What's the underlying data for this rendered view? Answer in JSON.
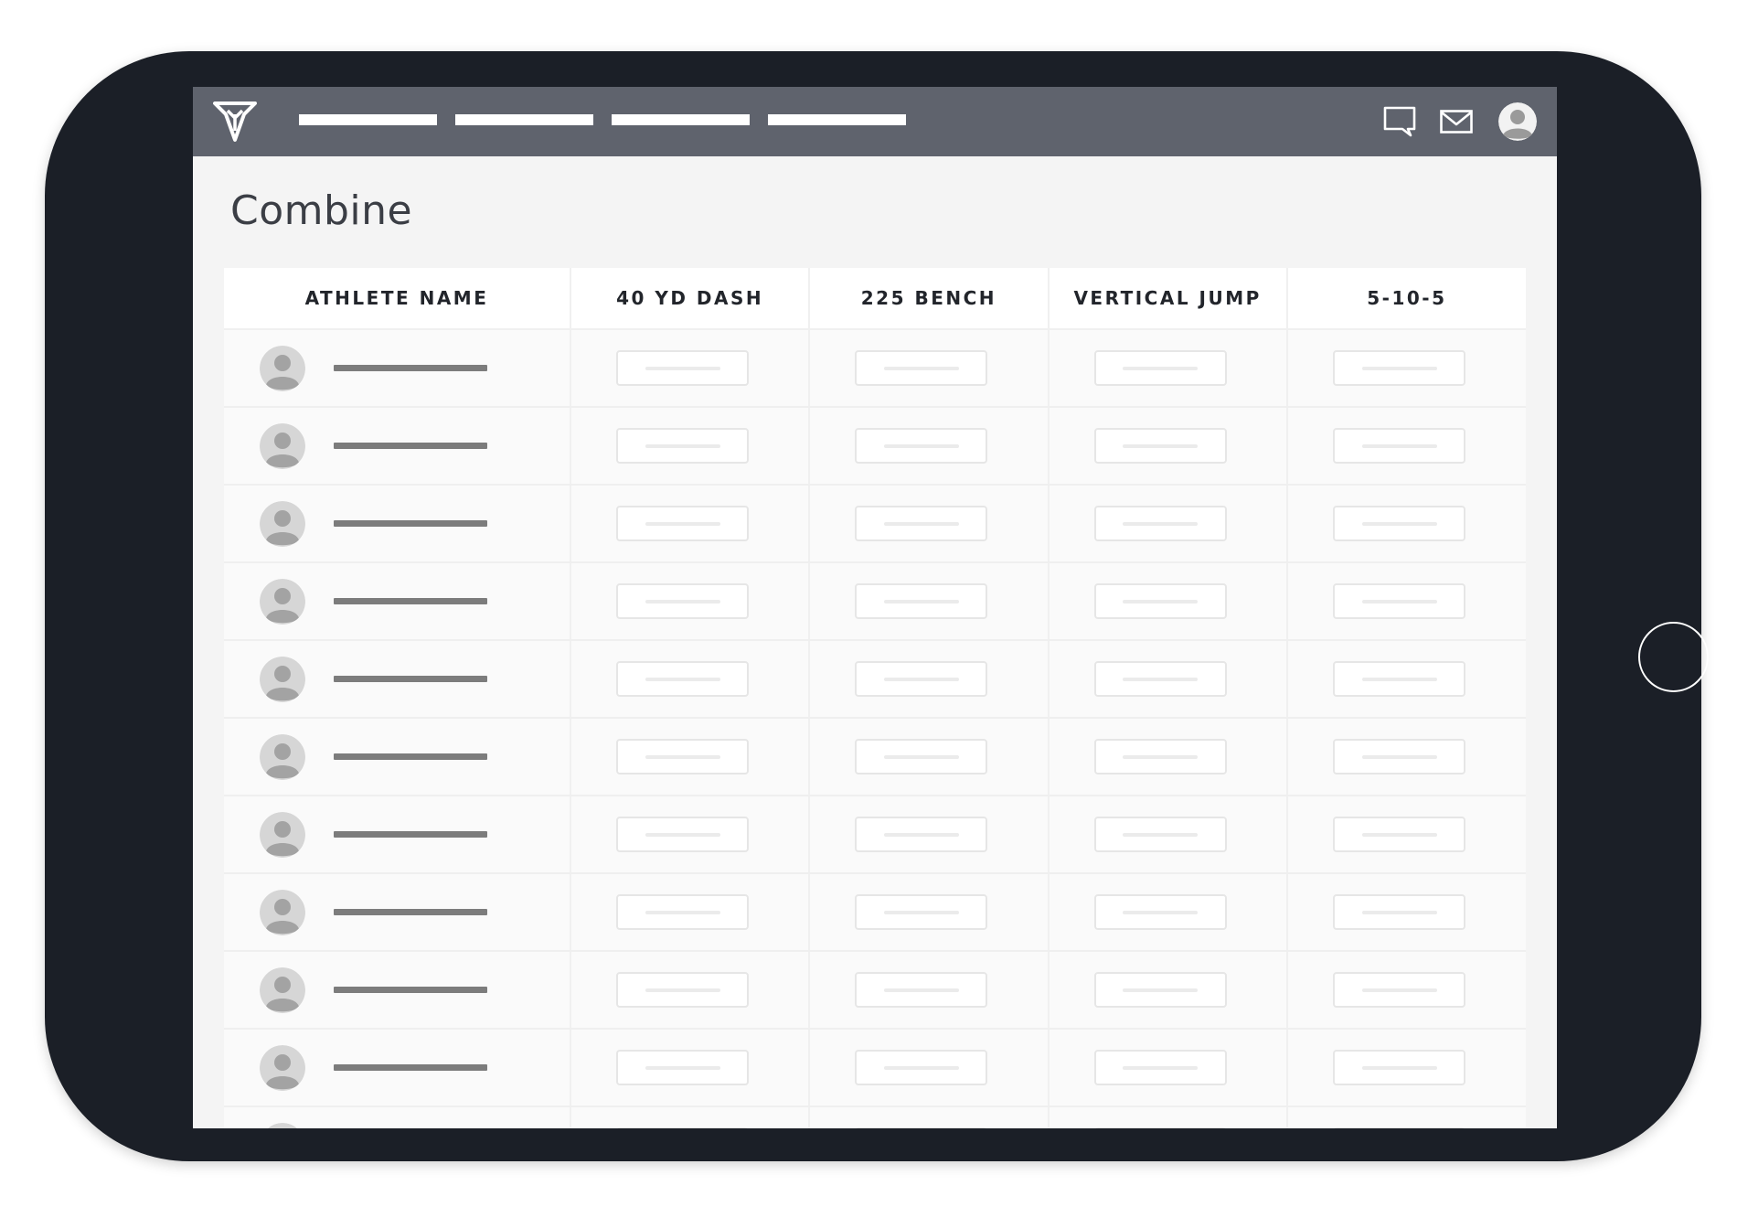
{
  "page": {
    "title": "Combine"
  },
  "navbar": {
    "logo_icon": "arrowhead-logo-icon",
    "links": [
      "",
      "",
      "",
      ""
    ],
    "right_icons": [
      "chat-icon",
      "mail-icon",
      "user-avatar-icon"
    ]
  },
  "table": {
    "columns": [
      "ATHLETE NAME",
      "40 YD DASH",
      "225 BENCH",
      "VERTICAL JUMP",
      "5-10-5"
    ],
    "rows": [
      {
        "name": "",
        "dash_40": "",
        "bench_225": "",
        "vertical_jump": "",
        "shuttle_5_10_5": ""
      },
      {
        "name": "",
        "dash_40": "",
        "bench_225": "",
        "vertical_jump": "",
        "shuttle_5_10_5": ""
      },
      {
        "name": "",
        "dash_40": "",
        "bench_225": "",
        "vertical_jump": "",
        "shuttle_5_10_5": ""
      },
      {
        "name": "",
        "dash_40": "",
        "bench_225": "",
        "vertical_jump": "",
        "shuttle_5_10_5": ""
      },
      {
        "name": "",
        "dash_40": "",
        "bench_225": "",
        "vertical_jump": "",
        "shuttle_5_10_5": ""
      },
      {
        "name": "",
        "dash_40": "",
        "bench_225": "",
        "vertical_jump": "",
        "shuttle_5_10_5": ""
      },
      {
        "name": "",
        "dash_40": "",
        "bench_225": "",
        "vertical_jump": "",
        "shuttle_5_10_5": ""
      },
      {
        "name": "",
        "dash_40": "",
        "bench_225": "",
        "vertical_jump": "",
        "shuttle_5_10_5": ""
      },
      {
        "name": "",
        "dash_40": "",
        "bench_225": "",
        "vertical_jump": "",
        "shuttle_5_10_5": ""
      },
      {
        "name": "",
        "dash_40": "",
        "bench_225": "",
        "vertical_jump": "",
        "shuttle_5_10_5": ""
      },
      {
        "name": "",
        "dash_40": "",
        "bench_225": "",
        "vertical_jump": "",
        "shuttle_5_10_5": ""
      }
    ]
  },
  "colors": {
    "device_frame": "#1b1f27",
    "navbar": "#5f636d",
    "screen_background": "#f4f4f4",
    "table_background": "#ffffff",
    "placeholder_text": "#7c7c7c",
    "input_border": "#e6e6e6"
  }
}
